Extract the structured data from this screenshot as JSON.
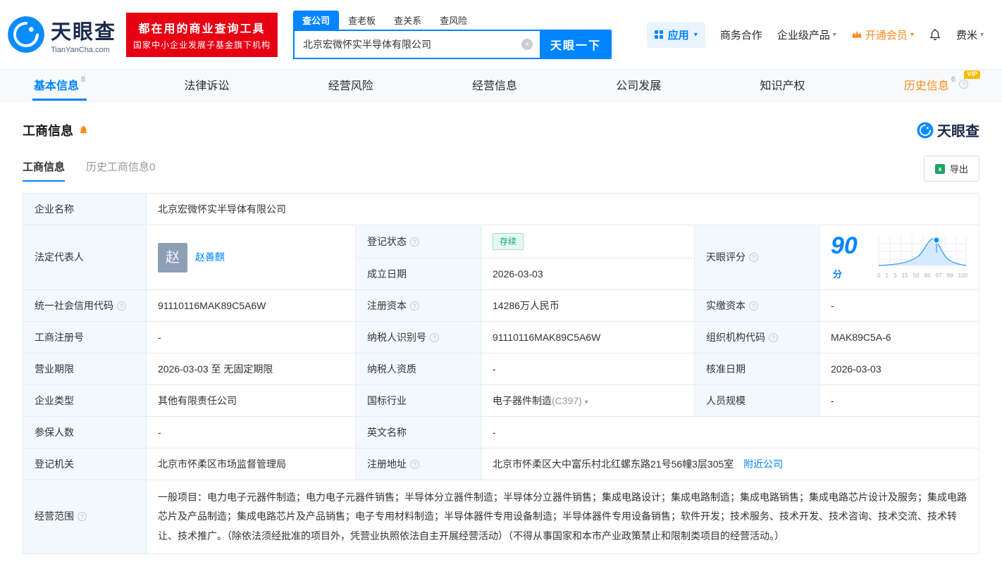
{
  "brand": {
    "name": "天眼查",
    "domain": "TianYanCha.com"
  },
  "banner": {
    "line1": "都在用的商业查询工具",
    "line2": "国家中小企业发展子基金旗下机构"
  },
  "search": {
    "tabs": [
      {
        "label": "查公司"
      },
      {
        "label": "查老板"
      },
      {
        "label": "查关系"
      },
      {
        "label": "查风险"
      }
    ],
    "value": "北京宏微怀实半导体有限公司",
    "button": "天眼一下"
  },
  "topnav": {
    "apps": "应用",
    "cooperation": "商务合作",
    "enterprise": "企业级产品",
    "vip": "开通会员",
    "user": "费米"
  },
  "tabs": [
    {
      "label": "基本信息",
      "count": "8"
    },
    {
      "label": "法律诉讼",
      "count": ""
    },
    {
      "label": "经营风险",
      "count": ""
    },
    {
      "label": "经营信息",
      "count": ""
    },
    {
      "label": "公司发展",
      "count": ""
    },
    {
      "label": "知识产权",
      "count": ""
    },
    {
      "label": "历史信息",
      "count": "6",
      "badge": "VIP"
    }
  ],
  "section": {
    "title": "工商信息",
    "watermark": "天眼查",
    "subtabs": [
      {
        "label": "工商信息"
      },
      {
        "label": "历史工商信息0"
      }
    ],
    "export": "导出"
  },
  "fields": {
    "company_name": {
      "label": "企业名称",
      "value": "北京宏微怀实半导体有限公司"
    },
    "legal_rep": {
      "label": "法定代表人",
      "avatar": "赵",
      "value": "赵善麒"
    },
    "reg_status": {
      "label": "登记状态",
      "value": "存续"
    },
    "establish_date": {
      "label": "成立日期",
      "value": "2026-03-03"
    },
    "score": {
      "label": "天眼评分",
      "value": "90",
      "unit": "分"
    },
    "credit_code": {
      "label": "统一社会信用代码",
      "value": "91110116MAK89C5A6W"
    },
    "reg_capital": {
      "label": "注册资本",
      "value": "14286万人民币"
    },
    "paid_capital": {
      "label": "实缴资本",
      "value": "-"
    },
    "reg_number": {
      "label": "工商注册号",
      "value": "-"
    },
    "taxpayer_id": {
      "label": "纳税人识别号",
      "value": "91110116MAK89C5A6W"
    },
    "org_code": {
      "label": "组织机构代码",
      "value": "MAK89C5A-6"
    },
    "business_term": {
      "label": "营业期限",
      "value": "2026-03-03 至 无固定期限"
    },
    "taxpayer_quality": {
      "label": "纳税人资质",
      "value": "-"
    },
    "approval_date": {
      "label": "核准日期",
      "value": "2026-03-03"
    },
    "company_type": {
      "label": "企业类型",
      "value": "其他有限责任公司"
    },
    "industry": {
      "label": "国标行业",
      "value": "电子器件制造",
      "code": "(C397)"
    },
    "staff_size": {
      "label": "人员规模",
      "value": "-"
    },
    "insured_count": {
      "label": "参保人数",
      "value": "-"
    },
    "english_name": {
      "label": "英文名称",
      "value": "-"
    },
    "reg_authority": {
      "label": "登记机关",
      "value": "北京市怀柔区市场监督管理局"
    },
    "reg_address": {
      "label": "注册地址",
      "value": "北京市怀柔区大中富乐村北红螺东路21号56幢3层305室",
      "link": "附近公司"
    },
    "business_scope": {
      "label": "经营范围",
      "value": "一般项目：电力电子元器件制造；电力电子元器件销售；半导体分立器件制造；半导体分立器件销售；集成电路设计；集成电路制造；集成电路销售；集成电路芯片设计及服务；集成电路芯片及产品制造；集成电路芯片及产品销售；电子专用材料制造；半导体器件专用设备制造；半导体器件专用设备销售；软件开发；技术服务、技术开发、技术咨询、技术交流、技术转让、技术推广。（除依法须经批准的项目外，凭营业执照依法自主开展经营活动）（不得从事国家和本市产业政策禁止和限制类项目的经营活动。）"
    }
  },
  "score_chart": {
    "type": "area",
    "score": 90,
    "x_ticks": [
      "0",
      "1",
      "3",
      "15",
      "50",
      "85",
      "97",
      "99",
      "100"
    ]
  }
}
